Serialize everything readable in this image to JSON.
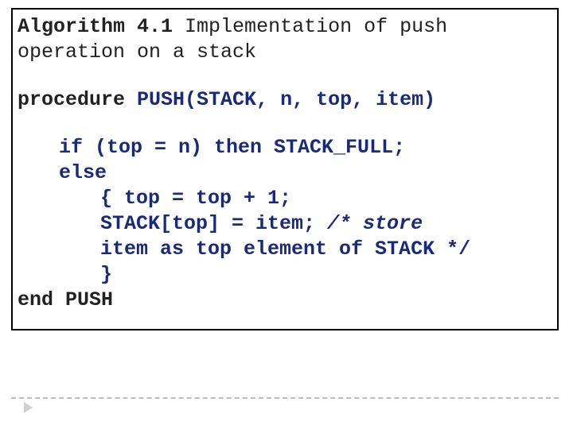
{
  "title_bold": "Algorithm 4.1",
  "title_rest": " Implementation of push operation on a stack",
  "proc_kw": "procedure",
  "proc_sig": "  PUSH(STACK, n, top, item)",
  "line_if": "if (top = n) then STACK_FULL;",
  "line_else": "else",
  "line_open": "{ top = top + 1;",
  "line_assign": "STACK[top] = item;",
  "cmt1": " /* store",
  "cmt2": "item as top element of STACK */",
  "line_close": "}",
  "line_end": "end PUSH"
}
